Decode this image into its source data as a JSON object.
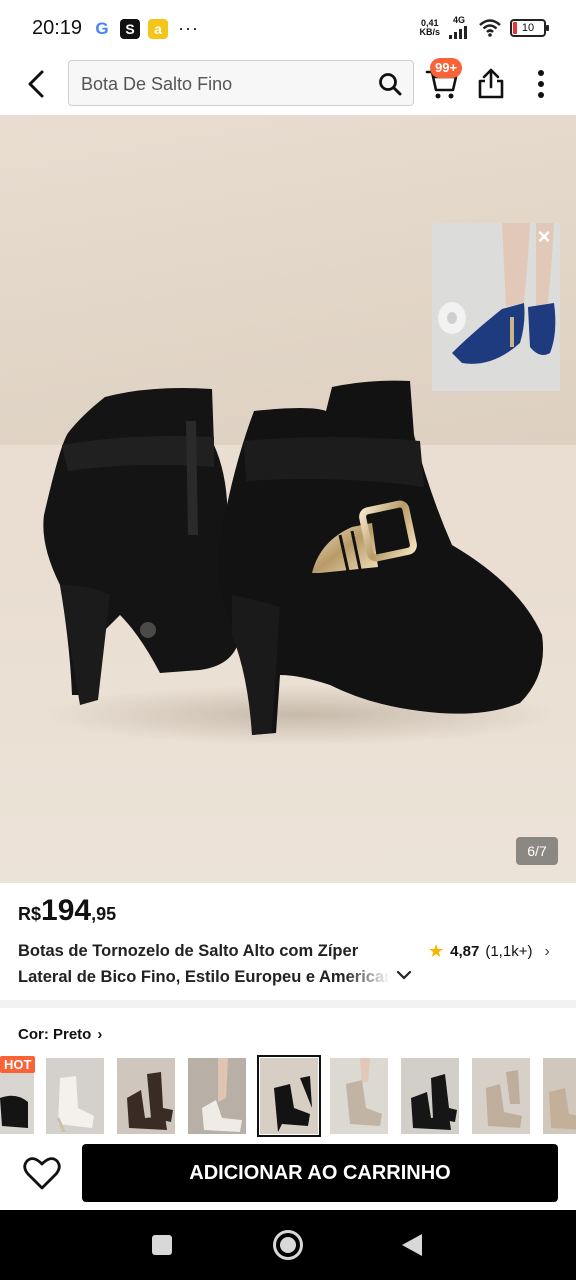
{
  "status_bar": {
    "time": "20:19",
    "app_icons": [
      "G",
      "S",
      "a"
    ],
    "more": "···",
    "net_speed_value": "0,41",
    "net_speed_unit": "KB/s",
    "network": "4G",
    "battery": "10"
  },
  "header": {
    "search_text": "Bota De Salto Fino",
    "cart_badge": "99+"
  },
  "gallery": {
    "page_indicator": "6/7"
  },
  "product": {
    "currency": "R$",
    "price_main": "194",
    "price_cents": ",95",
    "title_line1": "Botas de Tornozelo de Salto Alto com Zíper",
    "title_line2": "Lateral de Bico Fino, Estilo Europeu e Americano",
    "rating": "4,87",
    "reviews": "(1,1k+)"
  },
  "color": {
    "label": "Cor: Preto",
    "hot_badge": "HOT",
    "swatch_count": 9,
    "selected_index": 4
  },
  "actions": {
    "add_to_cart": "ADICIONAR AO CARRINHO"
  },
  "colors": {
    "accent": "#fa6338",
    "star": "#f5b500",
    "primary_button": "#000000"
  }
}
